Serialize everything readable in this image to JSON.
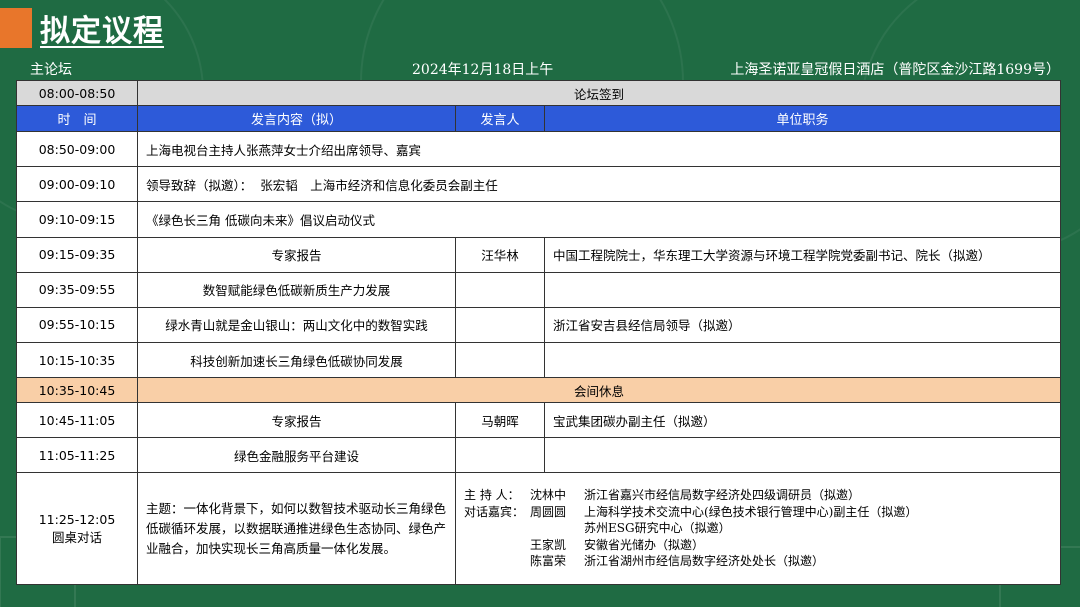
{
  "title": "拟定议程",
  "meta": {
    "session": "主论坛",
    "date": "2024年12月18日上午",
    "venue": "上海圣诺亚皇冠假日酒店（普陀区金沙江路1699号）"
  },
  "signin": {
    "time": "08:00-08:50",
    "label": "论坛签到"
  },
  "headers": {
    "time": "时　间",
    "content": "发言内容（拟）",
    "speaker": "发言人",
    "position": "单位职务"
  },
  "rows_a": [
    {
      "time": "08:50-09:00",
      "content": "上海电视台主持人张燕萍女士介绍出席领导、嘉宾"
    },
    {
      "time": "09:00-09:10",
      "content": "领导致辞（拟邀）：  张宏韬　上海市经济和信息化委员会副主任"
    },
    {
      "time": "09:10-09:15",
      "content": "《绿色长三角 低碳向未来》倡议启动仪式"
    }
  ],
  "rows_b": [
    {
      "time": "09:15-09:35",
      "content": "专家报告",
      "speaker": "汪华林",
      "position": "中国工程院院士，华东理工大学资源与环境工程学院党委副书记、院长（拟邀）"
    },
    {
      "time": "09:35-09:55",
      "content": "数智赋能绿色低碳新质生产力发展",
      "speaker": "",
      "position": ""
    },
    {
      "time": "09:55-10:15",
      "content": "绿水青山就是金山银山：两山文化中的数智实践",
      "speaker": "",
      "position": "浙江省安吉县经信局领导（拟邀）"
    },
    {
      "time": "10:15-10:35",
      "content": "科技创新加速长三角绿色低碳协同发展",
      "speaker": "",
      "position": ""
    }
  ],
  "break": {
    "time": "10:35-10:45",
    "label": "会间休息"
  },
  "rows_c": [
    {
      "time": "10:45-11:05",
      "content": "专家报告",
      "speaker": "马朝晖",
      "position": "宝武集团碳办副主任（拟邀）"
    },
    {
      "time": "11:05-11:25",
      "content": "绿色金融服务平台建设",
      "speaker": "",
      "position": ""
    }
  ],
  "roundtable": {
    "time": "11:25-12:05",
    "label": "圆桌对话",
    "topic": "主题：一体化背景下，如何以数智技术驱动长三角绿色低碳循环发展，以数据联通推进绿色生态协同、绿色产业融合，加快实现长三角高质量一体化发展。",
    "panel": [
      {
        "role": "主 持 人：",
        "name": "沈林中",
        "position": "浙江省嘉兴市经信局数字经济处四级调研员（拟邀）"
      },
      {
        "role": "对话嘉宾：",
        "name": "周圆圆",
        "position": "上海科学技术交流中心(绿色技术银行管理中心)副主任（拟邀）"
      },
      {
        "role": "",
        "name": "",
        "position": "苏州ESG研究中心（拟邀）"
      },
      {
        "role": "",
        "name": "王家凯",
        "position": "安徽省光储办（拟邀）"
      },
      {
        "role": "",
        "name": "陈富荣",
        "position": "浙江省湖州市经信局数字经济处处长（拟邀）"
      }
    ]
  },
  "colors": {
    "background": "#1f6b43",
    "accent": "#e8762b",
    "header": "#2d5ad9",
    "break": "#f9cfa7",
    "signin": "#d9d9d9"
  }
}
